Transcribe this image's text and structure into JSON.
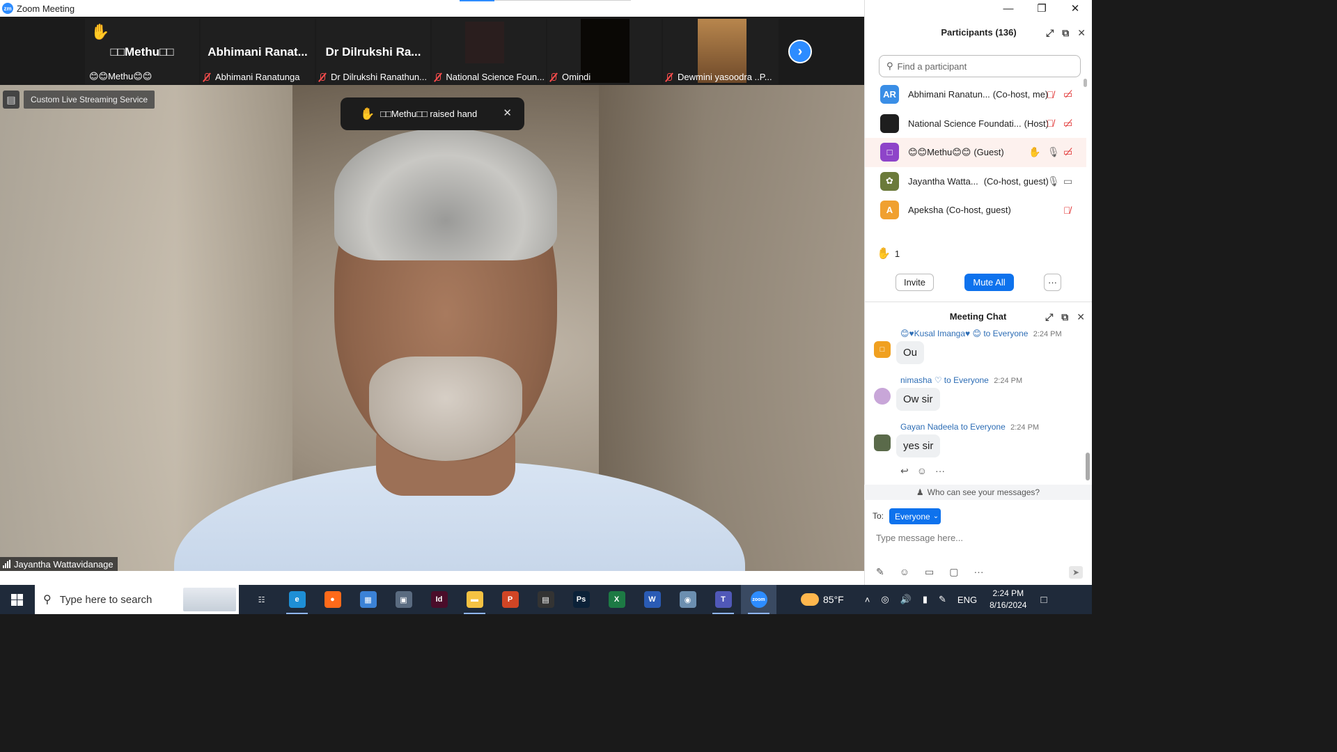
{
  "window": {
    "title": "Zoom Meeting",
    "logo_text": "zm"
  },
  "strip": {
    "tiles": [
      {
        "big_name": "□□Methu□□",
        "small_name": "😊😊Methu😊😊",
        "raised_hand": "✋"
      },
      {
        "big_name": "Abhimani  Ranat...",
        "small_name": "Abhimani Ranatunga"
      },
      {
        "big_name": "Dr  Dilrukshi  Ra...",
        "small_name": "Dr Dilrukshi Ranathun..."
      },
      {
        "big_name": "",
        "small_name": "National Science Foun..."
      },
      {
        "big_name": "",
        "small_name": "Omindi"
      },
      {
        "big_name": "",
        "small_name": "Dewmini yasoodra ..P..."
      }
    ],
    "next_icon": "›"
  },
  "main": {
    "stream_icon": "▤",
    "stream_label": "Custom Live Streaming Service",
    "toast": {
      "hand": "✋",
      "text": "□□Methu□□ raised hand",
      "close": "✕"
    },
    "speaker": "Jayantha Wattavidanage"
  },
  "participants": {
    "title": "Participants (136)",
    "search_placeholder": "Find a participant",
    "list": [
      {
        "initials": "AR",
        "color": "#3a8ee6",
        "name": "Abhimani Ranatun...",
        "role": "(Co-host, me)",
        "mic": "off",
        "video": "off"
      },
      {
        "initials": "",
        "color": "#1e1e1e",
        "name": "National Science Foundati...",
        "role": "(Host)",
        "mic": "off",
        "video": "off"
      },
      {
        "initials": "□",
        "color": "#8e44c9",
        "name": "😊😊Methu😊😊",
        "role": "(Guest)",
        "mic": "on",
        "video": "off",
        "hand": "✋"
      },
      {
        "initials": "✿",
        "color": "#6b7a3a",
        "name": "Jayantha Watta...",
        "role": "(Co-host, guest)",
        "mic": "on",
        "video": "on"
      },
      {
        "initials": "A",
        "color": "#f0a030",
        "name": "Apeksha",
        "role": "(Co-host, guest)",
        "mic": "off",
        "video": ""
      }
    ],
    "raised_count": "1",
    "raised_hand_icon": "✋",
    "invite_label": "Invite",
    "mute_all_label": "Mute All",
    "more_label": "···"
  },
  "chat": {
    "title": "Meeting Chat",
    "messages": [
      {
        "sender": "😊♥Kusal Imanga♥ 😊",
        "to": "to Everyone",
        "time": "2:24 PM",
        "text": "Ou",
        "avatar_color": "#f0a020",
        "avatar_text": "□"
      },
      {
        "sender": "nimasha ♡",
        "to": "to Everyone",
        "time": "2:24 PM",
        "text": "Ow sir",
        "avatar_color": "#c8a6d8",
        "avatar_text": ""
      },
      {
        "sender": "Gayan Nadeela",
        "to": "to Everyone",
        "time": "2:24 PM",
        "text": "yes sir",
        "avatar_color": "#5a6a4a",
        "avatar_text": ""
      }
    ],
    "who_can_see": "Who can see your messages?",
    "to_label": "To:",
    "to_value": "Everyone",
    "input_placeholder": "Type message here..."
  },
  "taskbar": {
    "search_placeholder": "Type here to search",
    "temperature": "85°F",
    "language": "ENG",
    "time": "2:24 PM",
    "date": "8/16/2024",
    "apps": [
      {
        "name": "task-view",
        "label": "☷",
        "color": "transparent"
      },
      {
        "name": "edge",
        "label": "e",
        "color": "#1e8fd6"
      },
      {
        "name": "firefox",
        "label": "●",
        "color": "#ff6a1a"
      },
      {
        "name": "store",
        "label": "▦",
        "color": "#3b82d6"
      },
      {
        "name": "calculator",
        "label": "▣",
        "color": "#5a6b80"
      },
      {
        "name": "indesign",
        "label": "Id",
        "color": "#4a0d2a"
      },
      {
        "name": "file-explorer",
        "label": "▬",
        "color": "#f5c242"
      },
      {
        "name": "powerpoint",
        "label": "P",
        "color": "#d04525"
      },
      {
        "name": "media-app",
        "label": "▤",
        "color": "#333333"
      },
      {
        "name": "photoshop",
        "label": "Ps",
        "color": "#0b2138"
      },
      {
        "name": "excel",
        "label": "X",
        "color": "#1d7a44"
      },
      {
        "name": "word",
        "label": "W",
        "color": "#2a5bb5"
      },
      {
        "name": "remote-app",
        "label": "◉",
        "color": "#6c8fb0"
      },
      {
        "name": "teams",
        "label": "T",
        "color": "#5058b8"
      },
      {
        "name": "zoom",
        "label": "zoom",
        "color": "#2d8cff"
      }
    ]
  }
}
